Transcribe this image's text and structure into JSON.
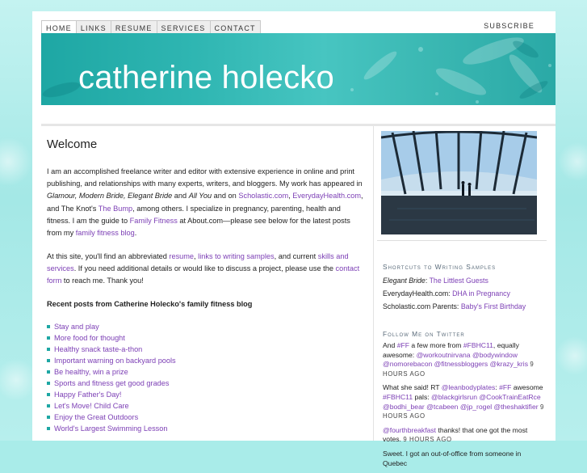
{
  "nav": {
    "items": [
      {
        "label": "HOME",
        "active": true
      },
      {
        "label": "LINKS"
      },
      {
        "label": "RESUME"
      },
      {
        "label": "SERVICES"
      },
      {
        "label": "CONTACT"
      }
    ],
    "subscribe": "SUBSCRIBE"
  },
  "header": {
    "site_title": "catherine holecko"
  },
  "main": {
    "heading": "Welcome",
    "intro": {
      "t1": "I am an accomplished freelance writer and editor with extensive experience in online and print publishing, and relationships with many experts, writers, and bloggers. My work has appeared in ",
      "pubs": "Glamour, Modern Bride, Elegant Bride",
      "t2": " and ",
      "pub_allyou": "All You",
      "t3": " and on ",
      "link_scholastic": "Scholastic.com",
      "t4": ", ",
      "link_everyday": "EverydayHealth.com",
      "t5": ", and The Knot's ",
      "link_bump": "The Bump",
      "t6": ", among others. I specialize in pregnancy, parenting, health and fitness. I am the guide to ",
      "link_family_fitness": "Family Fitness",
      "t7": " at About.com—please see below for the latest posts from my ",
      "link_blog": "family fitness blog",
      "t8": "."
    },
    "site_para": {
      "t1": "At this site, you'll find an abbreviated ",
      "link_resume": "resume",
      "t2": ", ",
      "link_samples": "links to writing samples",
      "t3": ", and current ",
      "link_skills": "skills and services",
      "t4": ". If you need additional details or would like to discuss a project, please use the ",
      "link_contact": "contact form",
      "t5": " to reach me. Thank you!"
    },
    "posts_heading": "Recent posts from Catherine Holecko's family fitness blog",
    "posts": [
      "Stay and play",
      "More food for thought",
      "Healthy snack taste-a-thon",
      "Important warning on backyard pools",
      "Be healthy, win a prize",
      "Sports and fitness get good grades",
      "Happy Father's Day!",
      "Let's Move! Child Care",
      "Enjoy the Great Outdoors",
      "World's Largest Swimming Lesson"
    ]
  },
  "sidebar": {
    "shortcuts_heading": "Shortcuts to Writing Samples",
    "shortcuts": [
      {
        "prefix": "Elegant Bride",
        "sep": ": ",
        "link": "The Littlest Guests",
        "italic": true
      },
      {
        "prefix": "EverydayHealth.com",
        "sep": ": ",
        "link": "DHA in Pregnancy"
      },
      {
        "prefix": "Scholastic.com Parents",
        "sep": ": ",
        "link": "Baby's First Birthday"
      }
    ],
    "twitter_heading": "Follow Me on Twitter",
    "tweets": {
      "t1": {
        "a": "And ",
        "h1": "#FF",
        "b": " a few more from ",
        "h2": "#FBHC11",
        "c": ", equally awesome: ",
        "m1": "@workoutnirvana",
        "m2": "@bodywindow",
        "m3": "@nomorebacon",
        "m4": "@fitnessbloggers",
        "m5": "@krazy_kris",
        "time": "9 HOURS AGO"
      },
      "t2": {
        "a": "What she said! RT ",
        "m1": "@leanbodyplates",
        "b": ": ",
        "h1": "#FF",
        "c": " awesome ",
        "h2": "#FBHC11",
        "d": " pals: ",
        "m2": "@blackgirlsrun",
        "m3": "@CookTrainEatRce",
        "m4": "@bodhi_bear",
        "m5": "@tcabeen",
        "m6": "@jp_rogel",
        "m7": "@theshaktifier",
        "time": "9 HOURS AGO"
      },
      "t3": {
        "m1": "@fourthbreakfast",
        "a": " thanks! that one got the most votes.",
        "time": "9 HOURS AGO"
      },
      "t4": {
        "a": "Sweet. I got an out-of-office from someone in Quebec"
      }
    }
  }
}
